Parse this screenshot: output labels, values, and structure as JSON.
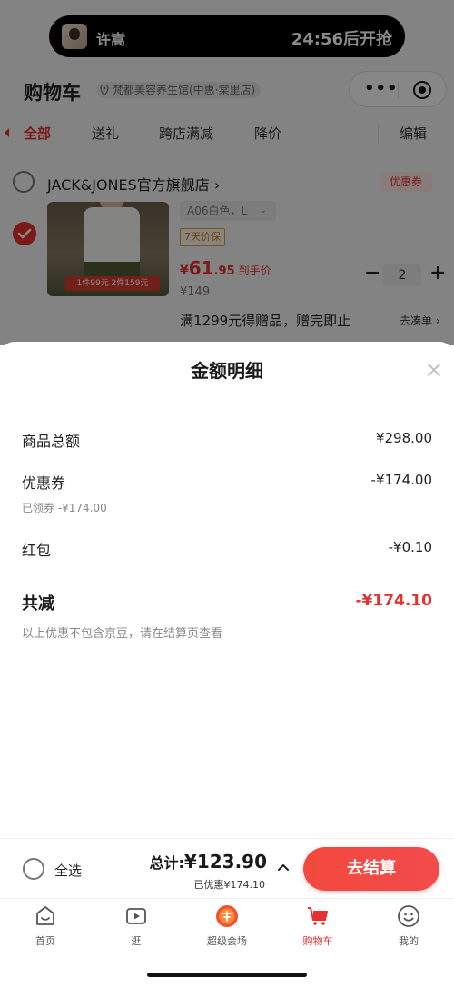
{
  "status": {
    "user_name": "许嵩",
    "countdown": "24:56后开抢"
  },
  "header": {
    "title": "购物车",
    "store_location": "梵都美容养生馆(中惠·棠里店)"
  },
  "tabs": [
    {
      "label": "全部",
      "active": true
    },
    {
      "label": "送礼"
    },
    {
      "label": "跨店满减"
    },
    {
      "label": "降价"
    },
    {
      "label": "编辑"
    }
  ],
  "store": {
    "name": "JACK&JONES官方旗舰店 ›",
    "coupon_label": "优惠券"
  },
  "item": {
    "promo_strip": "1件99元  2件159元",
    "variant": "A06白色，L",
    "price_guard": "7天价保",
    "price_yen": "¥",
    "price_int": "61",
    "price_dec": ".95",
    "price_label": "到手价",
    "original_price": "¥149",
    "quantity": "2",
    "gift_text": "满1299元得赠品，赠完即止",
    "gift_action": "去凑单 ›"
  },
  "sheet": {
    "title": "金额明细",
    "goods_total_label": "商品总额",
    "goods_total_value": "¥298.00",
    "coupon_label": "优惠券",
    "coupon_value": "-¥174.00",
    "coupon_sub": "已领券 -¥174.00",
    "redpacket_label": "红包",
    "redpacket_value": "-¥0.10",
    "total_reduce_label": "共减",
    "total_reduce_value": "-¥174.10",
    "note": "以上优惠不包含京豆，请在结算页查看"
  },
  "checkout": {
    "select_all": "全选",
    "total_label": "总计:",
    "total_amount": "¥123.90",
    "saved": "已优惠¥174.10",
    "pay_label": "去结算"
  },
  "tabbar": [
    {
      "label": "首页",
      "icon": "home-icon"
    },
    {
      "label": "逛",
      "icon": "video-icon"
    },
    {
      "label": "超级会场",
      "icon": "venue-icon"
    },
    {
      "label": "购物车",
      "icon": "cart-icon",
      "active": true
    },
    {
      "label": "我的",
      "icon": "smile-icon"
    }
  ],
  "colors": {
    "accent": "#e5312f",
    "text": "#1a1a1a",
    "muted": "#888888"
  }
}
